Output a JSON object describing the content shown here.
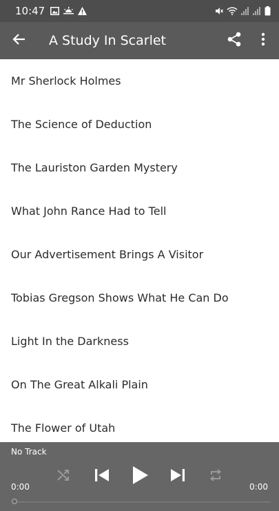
{
  "status_bar": {
    "time": "10:47"
  },
  "app_bar": {
    "title": "A Study In Scarlet"
  },
  "chapters": [
    "Mr Sherlock Holmes",
    "The Science of Deduction",
    "The Lauriston Garden Mystery",
    "What John Rance Had to Tell",
    "Our Advertisement Brings A Visitor",
    "Tobias Gregson Shows What He Can Do",
    "Light In the Darkness",
    "On The Great Alkali Plain",
    "The Flower of Utah"
  ],
  "player": {
    "track": "No Track",
    "elapsed": "0:00",
    "duration": "0:00",
    "progress": 0
  },
  "icons": {
    "back": "arrow-left-icon",
    "share": "share-icon",
    "more": "more-vertical-icon",
    "shuffle": "shuffle-icon",
    "previous": "skip-previous-icon",
    "play": "play-icon",
    "next": "skip-next-icon",
    "repeat": "repeat-icon"
  },
  "colors": {
    "status_bar": "#4d4d4d",
    "app_bar": "#5a5a5a",
    "player_bar": "#666666",
    "disabled_control": "#9a9a9a"
  }
}
